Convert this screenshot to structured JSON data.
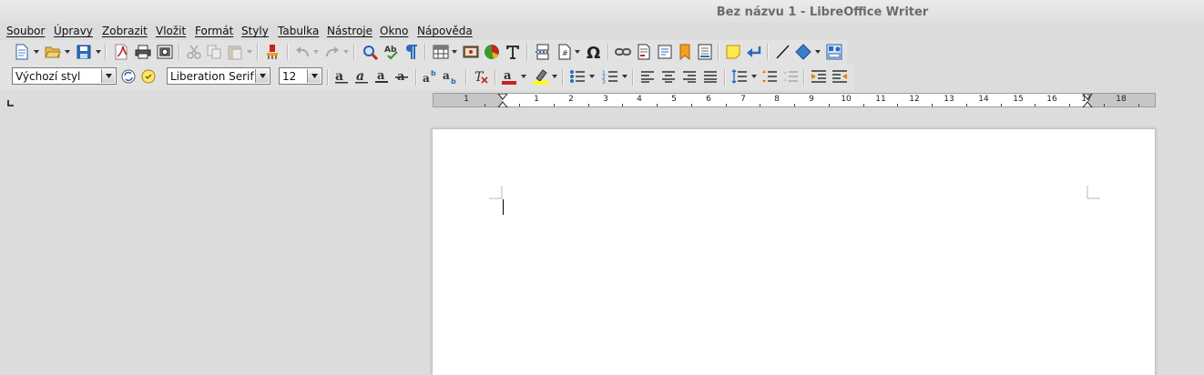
{
  "window": {
    "title": "Bez názvu 1 - LibreOffice Writer"
  },
  "menubar": {
    "items": [
      "Soubor",
      "Úpravy",
      "Zobrazit",
      "Vložit",
      "Formát",
      "Styly",
      "Tabulka",
      "Nástroje",
      "Okno",
      "Nápověda"
    ]
  },
  "formatting": {
    "paragraph_style": "Výchozí styl",
    "font_name": "Liberation Serif",
    "font_size": "12"
  },
  "ruler": {
    "unit": "cm",
    "labels": [
      "1",
      "1",
      "2",
      "3",
      "4",
      "5",
      "6",
      "7",
      "8",
      "9",
      "10",
      "11",
      "12",
      "13",
      "14",
      "15",
      "16",
      "17",
      "18"
    ]
  },
  "icons": {
    "standard": [
      "new-document-icon",
      "open-icon",
      "save-icon",
      "export-pdf-icon",
      "print-icon",
      "print-preview-icon",
      "cut-icon",
      "copy-icon",
      "paste-icon",
      "clone-formatting-icon",
      "undo-icon",
      "redo-icon",
      "find-replace-icon",
      "spelling-icon",
      "formatting-marks-icon",
      "table-icon",
      "image-icon",
      "chart-icon",
      "text-box-icon",
      "page-break-icon",
      "field-icon",
      "special-character-icon",
      "hyperlink-icon",
      "footnote-icon",
      "cross-reference-icon",
      "bookmark-icon",
      "endnote-icon",
      "comment-icon",
      "track-changes-icon",
      "line-icon",
      "shapes-icon",
      "basic-shapes-icon"
    ],
    "formatting": [
      "update-style-icon",
      "new-style-icon",
      "bold-icon",
      "italic-icon",
      "underline-icon",
      "strikethrough-icon",
      "superscript-icon",
      "subscript-icon",
      "clear-formatting-icon",
      "font-color-icon",
      "highlighting-icon",
      "bullets-icon",
      "numbering-icon",
      "align-left-icon",
      "align-center-icon",
      "align-right-icon",
      "justify-icon",
      "line-spacing-icon",
      "increase-paragraph-spacing-icon",
      "decrease-paragraph-spacing-icon",
      "increase-indent-icon",
      "decrease-indent-icon"
    ]
  },
  "colors": {
    "font_color": "#c9211e",
    "highlight_color": "#ffff00",
    "accent_blue": "#2a6bb8"
  }
}
